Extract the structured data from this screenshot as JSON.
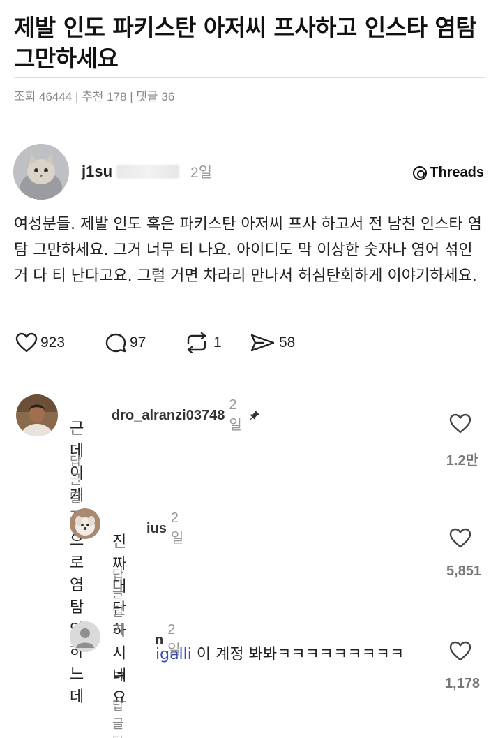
{
  "article": {
    "title": "제발 인도 파키스탄 아저씨 프사하고 인스타 염탐 그만하세요",
    "meta": "조회 46444 | 추천 178 | 댓글 36"
  },
  "post": {
    "username": "j1su",
    "time": "2일",
    "platform": "Threads",
    "body": "여성분들. 제발 인도 혹은 파키스탄 아저씨 프사 하고서 전 남친 인스타 염탐 그만하세요. 그거 너무 티 나요. 아이디도 막 이상한 숫자나 영어 섞인 거 다 티 난다고요. 그럴 거면 차라리 만나서 허심탄회하게 이야기하세요.",
    "likes": "923",
    "comments": "97",
    "reposts": "1",
    "shares": "58"
  },
  "comments": [
    {
      "username": "dro_alranzi03748",
      "time": "2일",
      "text": "근데이계정으로 염탐안하느데",
      "reply_label": "답글 달기",
      "likes": "1.2만"
    },
    {
      "username": "ius",
      "time": "2일",
      "text": "진짜 대단하시네요",
      "reply_label": "답글 달기",
      "likes": "5,851"
    },
    {
      "username": "n",
      "time": "2일",
      "mention": "igalli",
      "text": " 이 계정 봐봐ㅋㅋㅋㅋㅋㅋㅋㅋㅋ",
      "text_line2": "ㅋ",
      "reply_label": "답글 달기",
      "likes": "1,178"
    }
  ],
  "icons": {
    "like": "heart-icon",
    "comment": "speech-bubble-icon",
    "repost": "repost-icon",
    "share": "send-icon",
    "pin": "pin-icon",
    "platform": "threads-logo-icon"
  }
}
